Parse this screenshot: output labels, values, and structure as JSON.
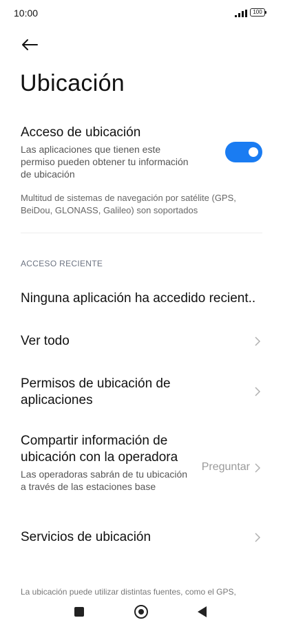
{
  "status_bar": {
    "time": "10:00",
    "battery": "100",
    "icons": [
      "signal-icon",
      "battery-icon"
    ]
  },
  "header": {
    "back_icon": "arrow-left-icon",
    "title": "Ubicación"
  },
  "location_access": {
    "title": "Acceso de ubicación",
    "description": "Las aplicaciones que tienen este permiso pueden obtener tu información de ubicación",
    "enabled": true,
    "toggle_color": "#1a7cf2",
    "note": "Multitud de sistemas de navegación por satélite (GPS, BeiDou, GLONASS, Galileo) son soportados"
  },
  "recent": {
    "section_label": "ACCESO RECIENTE",
    "empty_text": "Ninguna aplicación ha accedido recient.."
  },
  "items": [
    {
      "title": "Ver todo"
    },
    {
      "title": "Permisos de ubicación de aplicaciones"
    },
    {
      "title": "Compartir información de ubicación con la operadora",
      "subtitle": "Las operadoras sabrán de tu ubicación a través de las estaciones base",
      "value": "Preguntar"
    },
    {
      "title": "Servicios de ubicación"
    }
  ],
  "footer": {
    "note": "La ubicación puede utilizar distintas fuentes, como el GPS,"
  },
  "nav_bar": {
    "icons": [
      "recents-square-icon",
      "home-circle-icon",
      "back-triangle-icon"
    ]
  }
}
